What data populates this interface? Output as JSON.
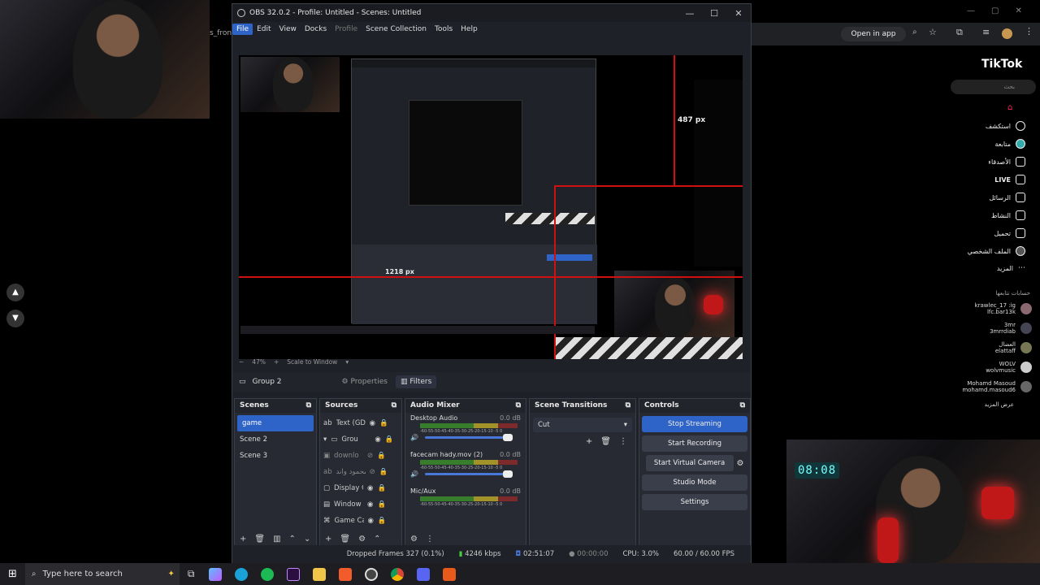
{
  "obs": {
    "title": "OBS 32.0.2 - Profile: Untitled - Scenes: Untitled",
    "menu": [
      "File",
      "Edit",
      "View",
      "Docks",
      "Profile",
      "Scene Collection",
      "Tools",
      "Help"
    ],
    "preview_overlay": {
      "px_label_1": "487 px",
      "px_label_2": "1218 px"
    },
    "zoom": {
      "minus": "−",
      "value": "47%",
      "plus": "+",
      "mode": "Scale to Window"
    },
    "source_bar": {
      "name": "Group 2",
      "properties": "Properties",
      "filters": "Filters"
    },
    "scenes": {
      "title": "Scenes",
      "items": [
        "game",
        "Scene 2",
        "Scene 3"
      ],
      "selected": 0
    },
    "sources": {
      "title": "Sources",
      "items": [
        "Text (GD",
        "Grou",
        "downlo",
        "محمود واند",
        "Display C",
        "Window",
        "Game Ca"
      ]
    },
    "mixer": {
      "title": "Audio Mixer",
      "channels": [
        {
          "name": "Desktop Audio",
          "db": "0.0 dB",
          "scale": "-60-55-50-45-40-35-30-25-20-15-10 -5  0"
        },
        {
          "name": "facecam hady.mov (2)",
          "db": "0.0 dB",
          "scale": "-60-55-50-45-40-35-30-25-20-15-10 -5  0"
        },
        {
          "name": "Mic/Aux",
          "db": "0.0 dB",
          "scale": "-60-55-50-45-40-35-30-25-20-15-10 -5  0"
        }
      ]
    },
    "transitions": {
      "title": "Scene Transitions",
      "selected": "Cut"
    },
    "controls": {
      "title": "Controls",
      "stop_streaming": "Stop Streaming",
      "start_recording": "Start Recording",
      "start_virtual_camera": "Start Virtual Camera",
      "studio_mode": "Studio Mode",
      "settings": "Settings"
    },
    "status": {
      "dropped": "Dropped Frames 327 (0.1%)",
      "bitrate": "4246 kbps",
      "stream_time": "02:51:07",
      "rec_time": "00:00:00",
      "cpu": "CPU: 3.0%",
      "fps": "60.00 / 60.00 FPS"
    }
  },
  "browser": {
    "tab_fragment": "s_fron",
    "open_in_app": "Open in app"
  },
  "tiktok": {
    "logo": "TikTok",
    "search_placeholder": "بحث",
    "nav": [
      "استكشف",
      "متابعة",
      "الأصدقاء",
      "LIVE",
      "الرسائل",
      "النشاط",
      "تحميل",
      "الملف الشخصي",
      "المزيد"
    ],
    "following_title": "حسابات تتابعها",
    "accounts": [
      {
        "name": "krawlec_17 :ig",
        "handle": "lfc.bar13k"
      },
      {
        "name": "3mr",
        "handle": "3mrrdiab"
      },
      {
        "name": "العضال",
        "handle": "elattaff"
      },
      {
        "name": "WOLV",
        "handle": "wolvmusic"
      },
      {
        "name": "Mohamd Masoud",
        "handle": "mohamd.masoud6"
      }
    ],
    "see_more": "عرض المزيد"
  },
  "cam": {
    "clock": "08:08"
  },
  "taskbar": {
    "search_placeholder": "Type here to search"
  }
}
